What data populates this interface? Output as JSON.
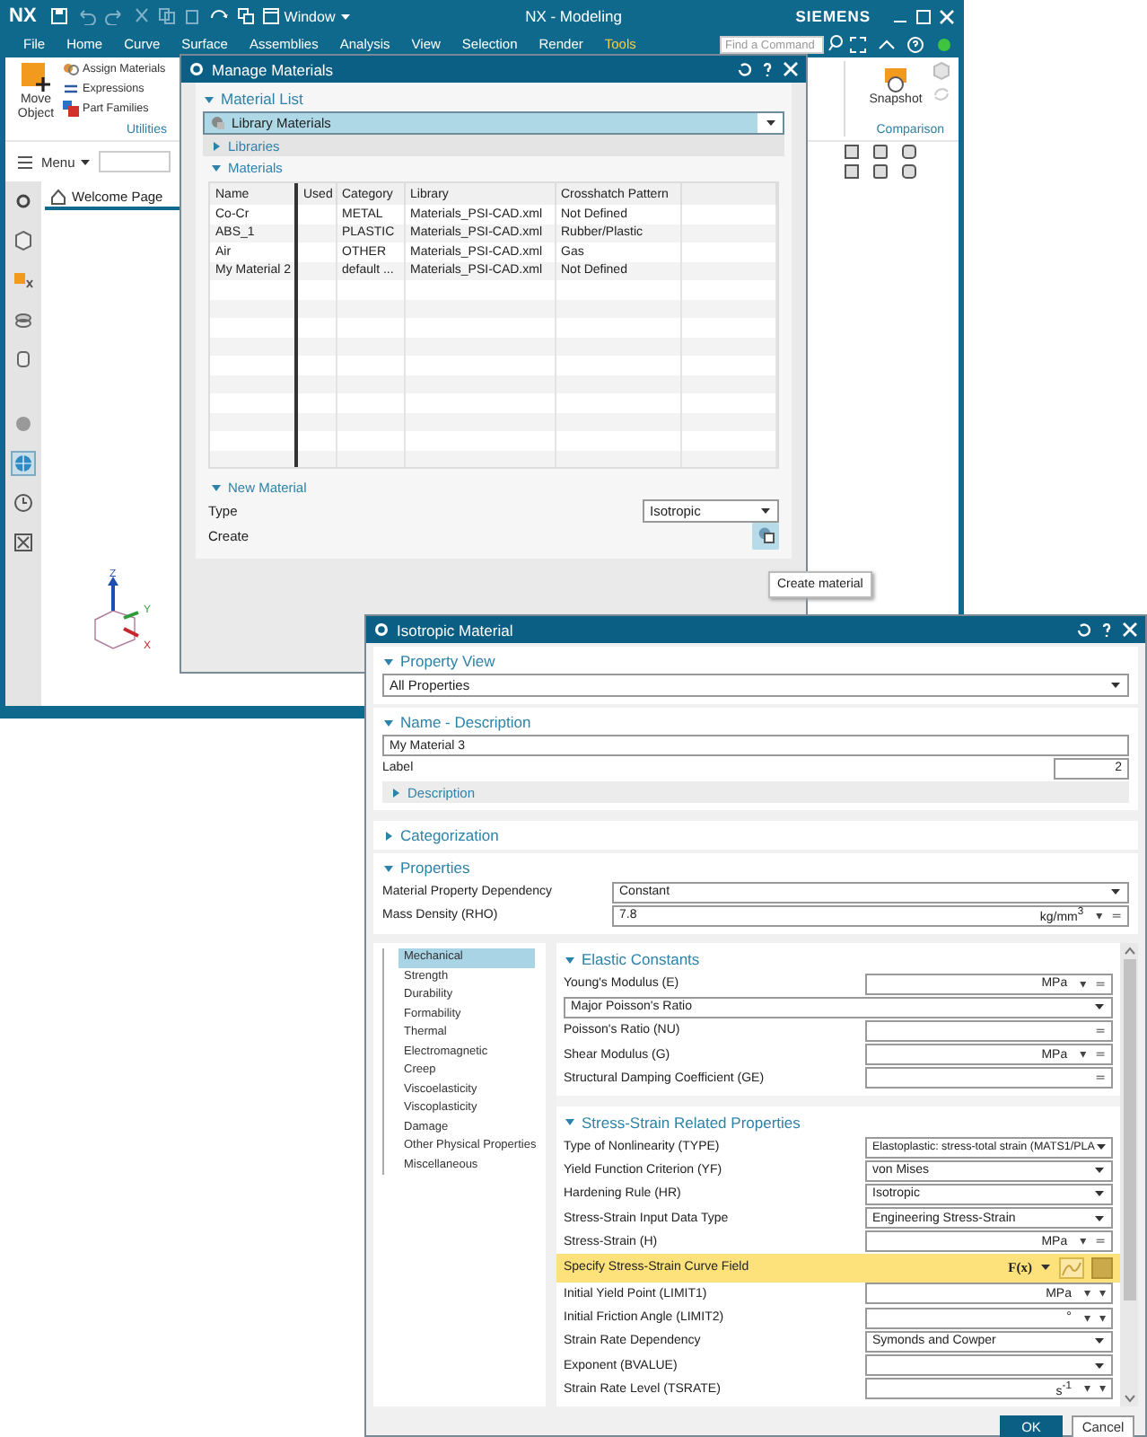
{
  "main_window": {
    "logo": "NX",
    "window_menu": "Window",
    "title": "NX - Modeling",
    "brand": "SIEMENS",
    "tabs": [
      {
        "label": "File",
        "selected": false
      },
      {
        "label": "Home",
        "selected": false
      },
      {
        "label": "Curve",
        "selected": false
      },
      {
        "label": "Surface",
        "selected": false
      },
      {
        "label": "Assemblies",
        "selected": false
      },
      {
        "label": "Analysis",
        "selected": false
      },
      {
        "label": "View",
        "selected": false
      },
      {
        "label": "Selection",
        "selected": false
      },
      {
        "label": "Render",
        "selected": false
      },
      {
        "label": "Tools",
        "selected": true
      }
    ],
    "search": {
      "placeholder": "Find a Command"
    },
    "ribbon": {
      "move_object": "Move Object",
      "tools": [
        "Assign Materials",
        "Expressions",
        "Part Families"
      ],
      "group_label": "Utilities",
      "snapshot": "Snapshot",
      "comparison_label": "Comparison"
    },
    "menu_button": "Menu",
    "doc_tab": "Welcome Page",
    "axes": [
      "Z",
      "Y",
      "X"
    ]
  },
  "manage_materials": {
    "title": "Manage Materials",
    "material_list": {
      "label": "Material List",
      "expanded": true,
      "source": "Library Materials",
      "libraries": {
        "label": "Libraries",
        "expanded": false
      },
      "materials": {
        "label": "Materials",
        "expanded": true,
        "columns": [
          "Name",
          "Used",
          "Category",
          "Library",
          "Crosshatch Pattern"
        ],
        "rows": [
          [
            "Co-Cr",
            "",
            "METAL",
            "Materials_PSI-CAD.xml",
            "Not Defined"
          ],
          [
            "ABS_1",
            "",
            "PLASTIC",
            "Materials_PSI-CAD.xml",
            "Rubber/Plastic"
          ],
          [
            "Air",
            "",
            "OTHER",
            "Materials_PSI-CAD.xml",
            "Gas"
          ],
          [
            "My Material 2",
            "",
            "default ...",
            "Materials_PSI-CAD.xml",
            "Not Defined"
          ]
        ]
      }
    },
    "new_material": {
      "label": "New Material",
      "expanded": true,
      "type_label": "Type",
      "type_value": "Isotropic",
      "create_label": "Create",
      "create_highlighted": true
    },
    "tooltip": "Create material"
  },
  "isotropic_material": {
    "title": "Isotropic Material",
    "property_view": {
      "label": "Property View",
      "expanded": true,
      "value": "All Properties"
    },
    "name_description": {
      "label": "Name - Description",
      "expanded": true,
      "name": "My Material 3",
      "label_field": {
        "label": "Label",
        "value": "2"
      },
      "description": {
        "label": "Description",
        "expanded": false
      }
    },
    "categorization": {
      "label": "Categorization",
      "expanded": false
    },
    "properties": {
      "label": "Properties",
      "expanded": true,
      "rows": [
        {
          "kind": "dropdown",
          "label": "Material Property Dependency",
          "value": "Constant"
        },
        {
          "kind": "field",
          "label": "Mass Density (RHO)",
          "value": "7.8",
          "unit": "kg/mm$^{3}$",
          "controls": [
            "▾",
            "="
          ]
        }
      ]
    },
    "categories": [
      {
        "label": "Mechanical",
        "selected": true
      },
      {
        "label": "Strength",
        "selected": false
      },
      {
        "label": "Durability",
        "selected": false
      },
      {
        "label": "Formability",
        "selected": false
      },
      {
        "label": "Thermal",
        "selected": false
      },
      {
        "label": "Electromagnetic",
        "selected": false
      },
      {
        "label": "Creep",
        "selected": false
      },
      {
        "label": "Viscoelasticity",
        "selected": false
      },
      {
        "label": "Viscoplasticity",
        "selected": false
      },
      {
        "label": "Damage",
        "selected": false
      },
      {
        "label": "Other Physical Properties",
        "selected": false
      },
      {
        "label": "Miscellaneous",
        "selected": false
      }
    ],
    "groups": [
      {
        "label": "Elastic Constants",
        "expanded": true,
        "rows": [
          {
            "kind": "field",
            "label": "Young's Modulus (E)",
            "unit": "MPa",
            "controls": [
              "▾",
              "="
            ]
          },
          {
            "kind": "wide_dropdown",
            "value": "Major Poisson's Ratio"
          },
          {
            "kind": "field",
            "label": "Poisson's Ratio (NU)",
            "controls": [
              "="
            ]
          },
          {
            "kind": "field",
            "label": "Shear Modulus (G)",
            "unit": "MPa",
            "controls": [
              "▾",
              "="
            ]
          },
          {
            "kind": "field",
            "label": "Structural Damping Coefficient (GE)",
            "controls": [
              "="
            ]
          }
        ]
      },
      {
        "label": "Stress-Strain Related Properties",
        "expanded": true,
        "rows": [
          {
            "kind": "dropdown",
            "label": "Type of Nonlinearity (TYPE)",
            "value": "Elastoplastic: stress-total strain (MATS1/PLA"
          },
          {
            "kind": "dropdown",
            "label": "Yield Function Criterion (YF)",
            "value": "von Mises"
          },
          {
            "kind": "dropdown",
            "label": "Hardening Rule (HR)",
            "value": "Isotropic"
          },
          {
            "kind": "dropdown",
            "label": "Stress-Strain Input Data Type",
            "value": "Engineering Stress-Strain"
          },
          {
            "kind": "field",
            "label": "Stress-Strain (H)",
            "unit": "MPa",
            "controls": [
              "▾",
              "="
            ]
          },
          {
            "kind": "curve",
            "label": "Specify Stress-Strain Curve Field",
            "function": "F(x)"
          },
          {
            "kind": "field",
            "label": "Initial Yield Point (LIMIT1)",
            "unit": "MPa",
            "controls": [
              "▾",
              "▾"
            ]
          },
          {
            "kind": "field",
            "label": "Initial Friction Angle (LIMIT2)",
            "unit": "°",
            "controls": [
              "▾",
              "▾"
            ]
          },
          {
            "kind": "dropdown",
            "label": "Strain Rate Dependency",
            "value": "Symonds and Cowper"
          },
          {
            "kind": "dropdown",
            "label": "Exponent (BVALUE)"
          },
          {
            "kind": "field",
            "label": "Strain Rate Level (TSRATE)",
            "unit": "s$^{-1}$",
            "controls": [
              "▾",
              "▾"
            ]
          }
        ]
      }
    ],
    "buttons": [
      {
        "label": "OK",
        "kind": "primary"
      },
      {
        "label": "Cancel",
        "kind": "secondary"
      }
    ]
  }
}
